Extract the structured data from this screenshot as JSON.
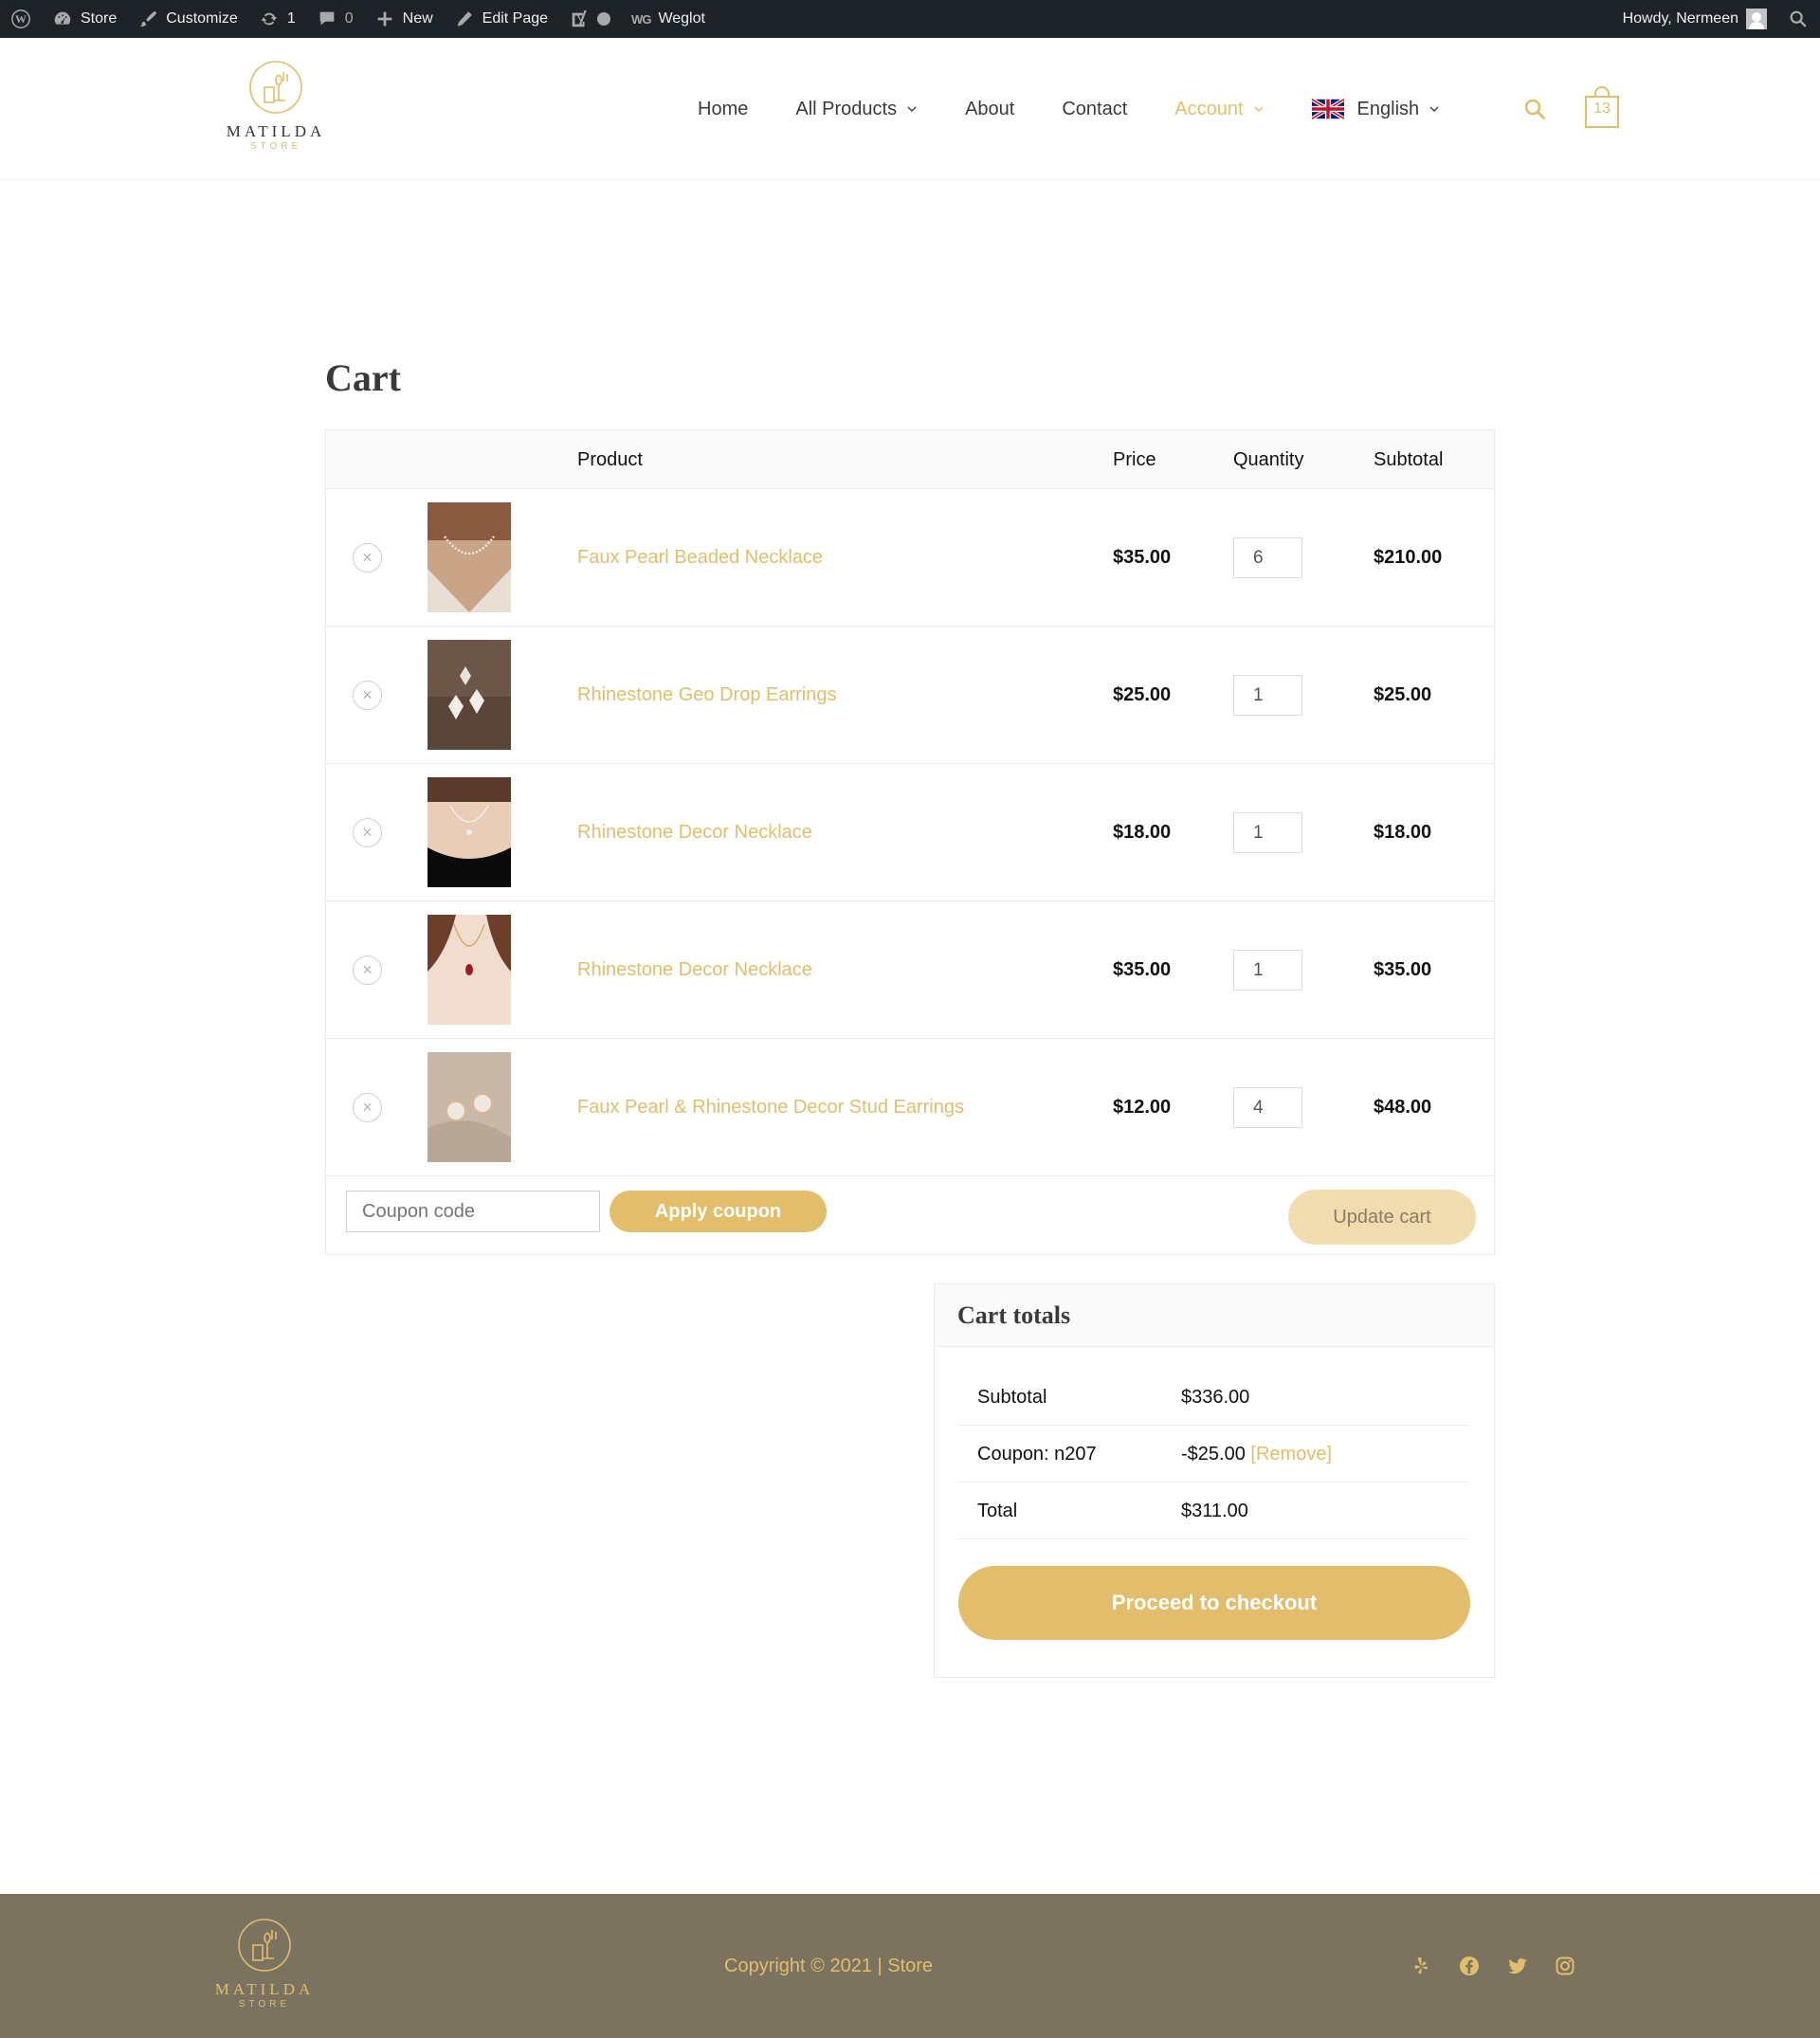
{
  "admin_bar": {
    "store": "Store",
    "customize": "Customize",
    "updates_count": "1",
    "comments_count": "0",
    "new": "New",
    "edit_page": "Edit Page",
    "weglot": "Weglot",
    "weglot_badge": "WG",
    "howdy": "Howdy, Nermeen"
  },
  "logo": {
    "name": "MATILDA",
    "sub": "STORE"
  },
  "nav": {
    "home": "Home",
    "all_products": "All Products",
    "about": "About",
    "contact": "Contact",
    "account": "Account",
    "language": "English"
  },
  "cart_count": "13",
  "page_title": "Cart",
  "table": {
    "headers": {
      "product": "Product",
      "price": "Price",
      "quantity": "Quantity",
      "subtotal": "Subtotal"
    },
    "rows": [
      {
        "name": "Faux Pearl Beaded Necklace",
        "price": "$35.00",
        "qty": "6",
        "subtotal": "$210.00"
      },
      {
        "name": "Rhinestone Geo Drop Earrings",
        "price": "$25.00",
        "qty": "1",
        "subtotal": "$25.00"
      },
      {
        "name": "Rhinestone Decor Necklace",
        "price": "$18.00",
        "qty": "1",
        "subtotal": "$18.00"
      },
      {
        "name": "Rhinestone Decor Necklace",
        "price": "$35.00",
        "qty": "1",
        "subtotal": "$35.00"
      },
      {
        "name": "Faux Pearl & Rhinestone Decor Stud Earrings",
        "price": "$12.00",
        "qty": "4",
        "subtotal": "$48.00"
      }
    ],
    "remove_glyph": "×"
  },
  "coupon": {
    "placeholder": "Coupon code",
    "apply": "Apply coupon",
    "update": "Update cart"
  },
  "totals": {
    "title": "Cart totals",
    "subtotal_label": "Subtotal",
    "subtotal_value": "$336.00",
    "coupon_label": "Coupon: n207",
    "coupon_value": "-$25.00",
    "remove_link": "[Remove]",
    "total_label": "Total",
    "total_value": "$311.00",
    "checkout": "Proceed to checkout"
  },
  "footer": {
    "copyright": "Copyright © 2021 | Store"
  },
  "colors": {
    "accent": "#e2bd6b",
    "admin_bar": "#1d2327",
    "footer": "#7b7360"
  }
}
